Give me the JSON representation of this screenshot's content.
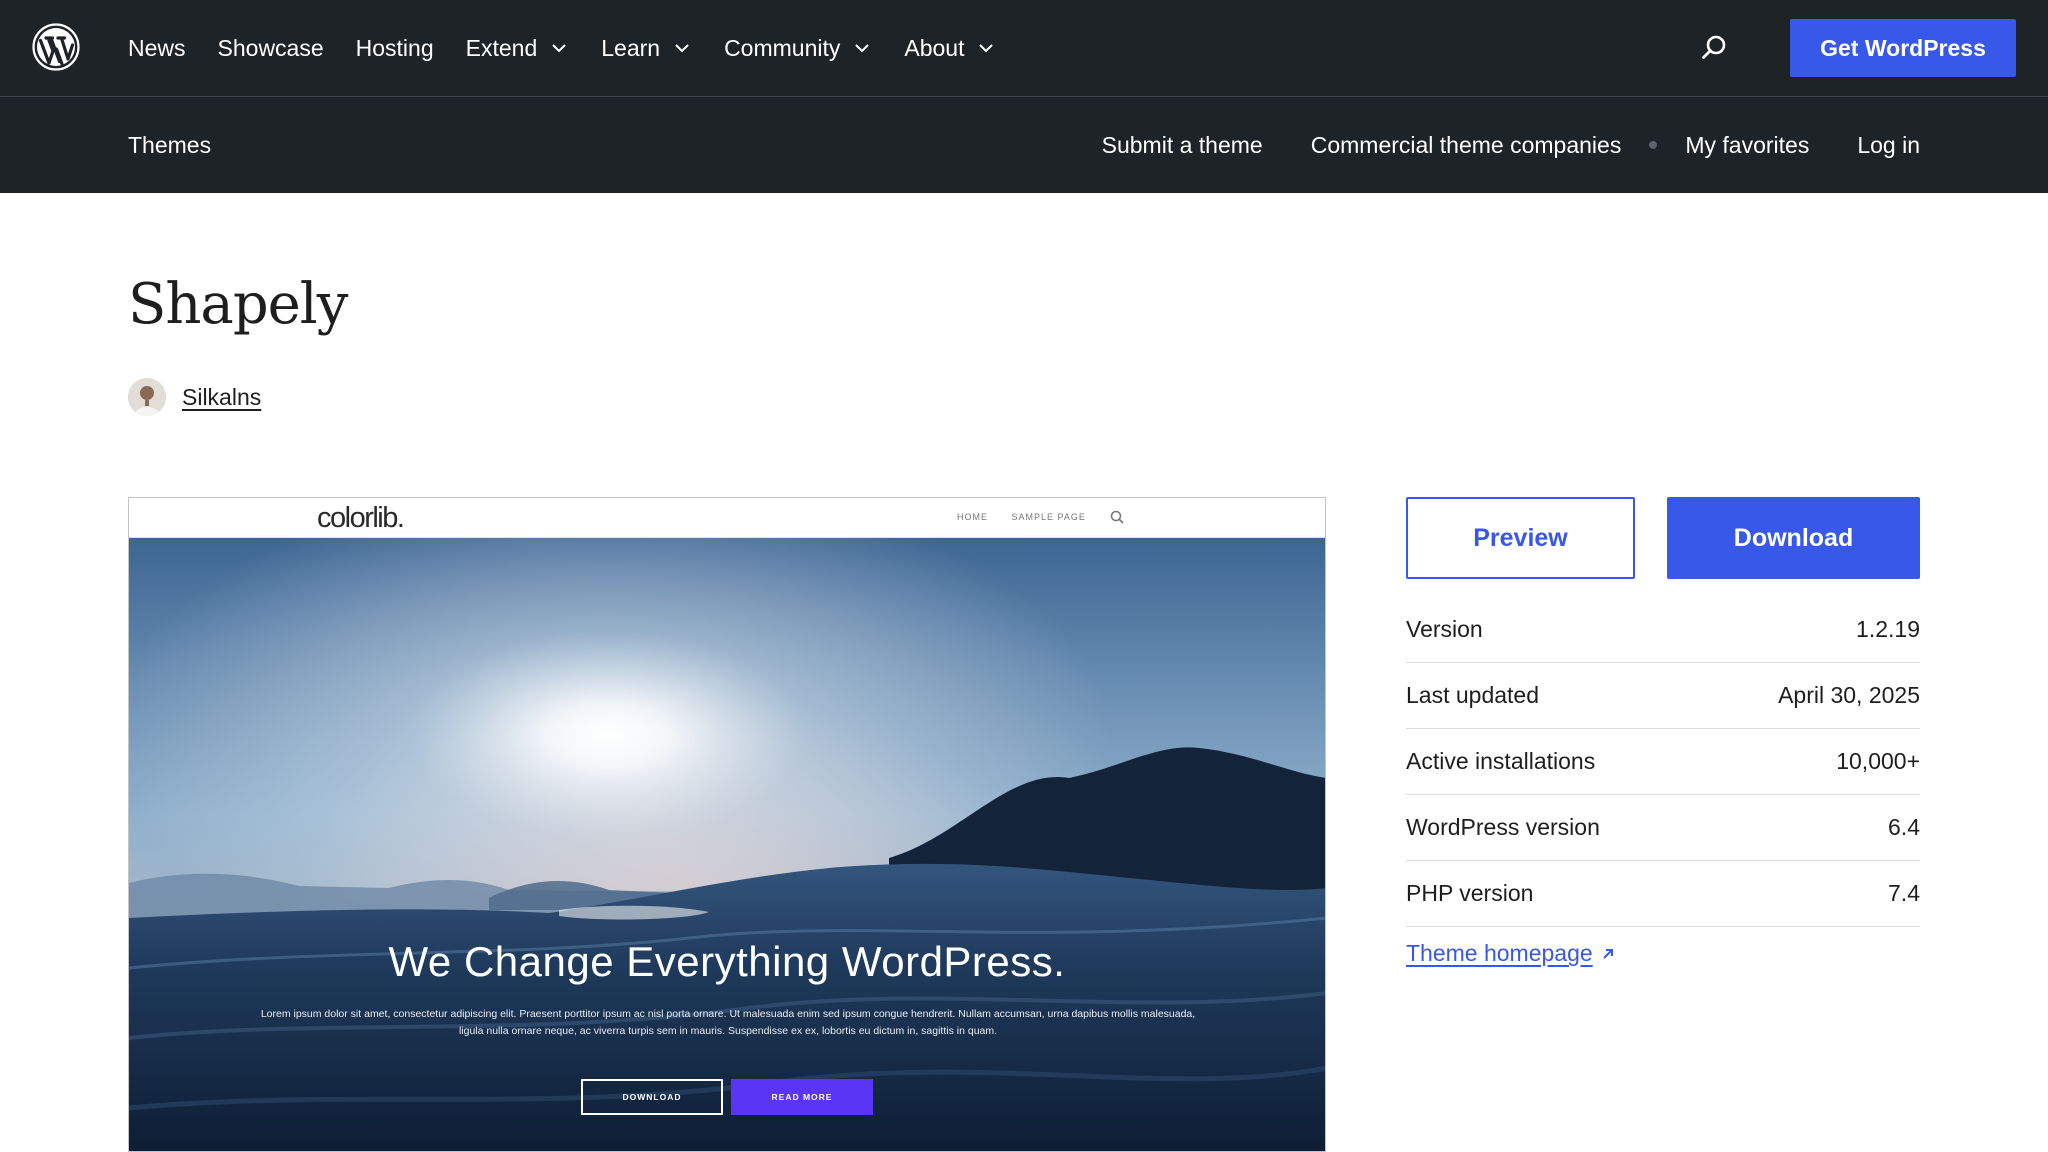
{
  "header": {
    "nav": [
      {
        "label": "News"
      },
      {
        "label": "Showcase"
      },
      {
        "label": "Hosting"
      },
      {
        "label": "Extend"
      },
      {
        "label": "Learn"
      },
      {
        "label": "Community"
      },
      {
        "label": "About"
      }
    ],
    "cta_label": "Get WordPress",
    "accent_color": "#3858e9",
    "background_color": "#1d2327"
  },
  "local_nav": {
    "title": "Themes",
    "links": [
      "Submit a theme",
      "Commercial theme companies",
      "My favorites",
      "Log in"
    ]
  },
  "theme": {
    "name": "Shapely",
    "author": "Silkalns"
  },
  "screenshot": {
    "logo": "colorlib.",
    "menu": [
      "HOME",
      "SAMPLE PAGE"
    ],
    "heading": "We Change Everything WordPress.",
    "body": "Lorem ipsum dolor sit amet, consectetur adipiscing elit. Praesent porttitor ipsum ac nisl porta ornare. Ut malesuada enim sed ipsum congue hendrerit. Nullam accumsan, urna dapibus mollis malesuada, ligula nulla ornare neque, ac viverra turpis sem in mauris. Suspendisse ex ex, lobortis eu dictum in, sagittis in quam.",
    "btn_primary": "DOWNLOAD",
    "btn_secondary": "READ MORE"
  },
  "actions": {
    "preview_label": "Preview",
    "download_label": "Download"
  },
  "meta": [
    {
      "label": "Version",
      "value": "1.2.19"
    },
    {
      "label": "Last updated",
      "value": "April 30, 2025"
    },
    {
      "label": "Active installations",
      "value": "10,000+"
    },
    {
      "label": "WordPress version",
      "value": "6.4"
    },
    {
      "label": "PHP version",
      "value": "7.4"
    }
  ],
  "theme_homepage_label": "Theme homepage"
}
